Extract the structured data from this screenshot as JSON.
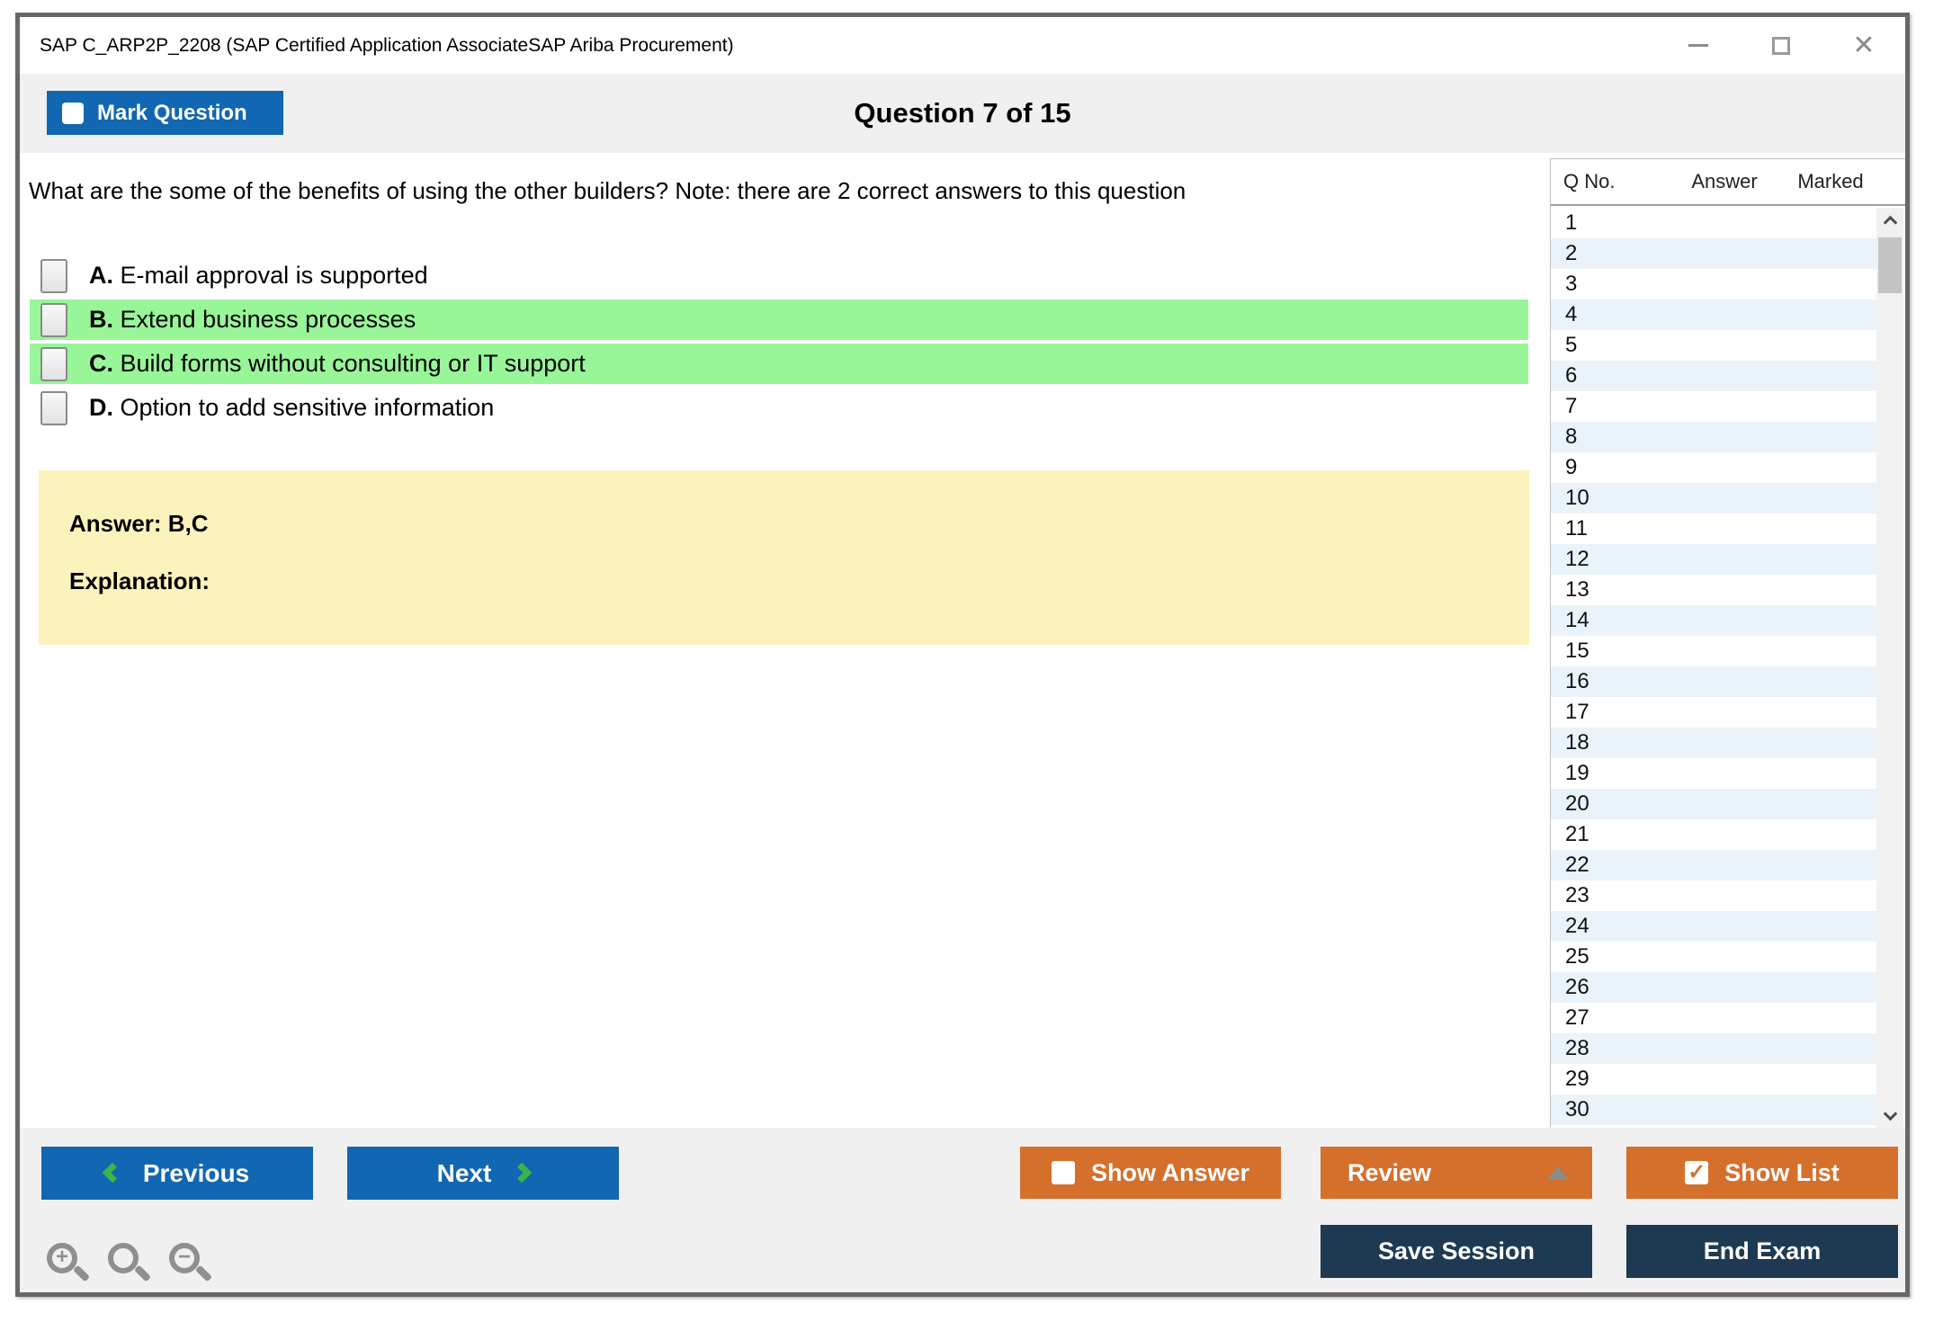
{
  "window": {
    "title": "SAP C_ARP2P_2208 (SAP Certified Application AssociateSAP Ariba Procurement)"
  },
  "header": {
    "mark_question_label": "Mark Question",
    "question_counter": "Question 7 of 15"
  },
  "question": {
    "text": "What are the some of the benefits of using the other builders? Note: there are 2 correct answers to this question",
    "options": [
      {
        "letter": "A.",
        "text": "E-mail approval is supported",
        "highlighted": false,
        "checked": false
      },
      {
        "letter": "B.",
        "text": "Extend business processes",
        "highlighted": true,
        "checked": false
      },
      {
        "letter": "C.",
        "text": "Build forms without consulting or IT support",
        "highlighted": true,
        "checked": false
      },
      {
        "letter": "D.",
        "text": "Option to add sensitive information",
        "highlighted": false,
        "checked": false
      }
    ]
  },
  "answer_panel": {
    "answer": "Answer: B,C",
    "explanation": "Explanation:"
  },
  "sidebar": {
    "columns": [
      "Q No.",
      "Answer",
      "Marked"
    ],
    "rows": [
      {
        "q": "1",
        "answer": "",
        "marked": ""
      },
      {
        "q": "2",
        "answer": "",
        "marked": ""
      },
      {
        "q": "3",
        "answer": "",
        "marked": ""
      },
      {
        "q": "4",
        "answer": "",
        "marked": ""
      },
      {
        "q": "5",
        "answer": "",
        "marked": ""
      },
      {
        "q": "6",
        "answer": "",
        "marked": ""
      },
      {
        "q": "7",
        "answer": "",
        "marked": ""
      },
      {
        "q": "8",
        "answer": "",
        "marked": ""
      },
      {
        "q": "9",
        "answer": "",
        "marked": ""
      },
      {
        "q": "10",
        "answer": "",
        "marked": ""
      },
      {
        "q": "11",
        "answer": "",
        "marked": ""
      },
      {
        "q": "12",
        "answer": "",
        "marked": ""
      },
      {
        "q": "13",
        "answer": "",
        "marked": ""
      },
      {
        "q": "14",
        "answer": "",
        "marked": ""
      },
      {
        "q": "15",
        "answer": "",
        "marked": ""
      },
      {
        "q": "16",
        "answer": "",
        "marked": ""
      },
      {
        "q": "17",
        "answer": "",
        "marked": ""
      },
      {
        "q": "18",
        "answer": "",
        "marked": ""
      },
      {
        "q": "19",
        "answer": "",
        "marked": ""
      },
      {
        "q": "20",
        "answer": "",
        "marked": ""
      },
      {
        "q": "21",
        "answer": "",
        "marked": ""
      },
      {
        "q": "22",
        "answer": "",
        "marked": ""
      },
      {
        "q": "23",
        "answer": "",
        "marked": ""
      },
      {
        "q": "24",
        "answer": "",
        "marked": ""
      },
      {
        "q": "25",
        "answer": "",
        "marked": ""
      },
      {
        "q": "26",
        "answer": "",
        "marked": ""
      },
      {
        "q": "27",
        "answer": "",
        "marked": ""
      },
      {
        "q": "28",
        "answer": "",
        "marked": ""
      },
      {
        "q": "29",
        "answer": "",
        "marked": ""
      },
      {
        "q": "30",
        "answer": "",
        "marked": ""
      }
    ]
  },
  "footer": {
    "previous_label": "Previous",
    "next_label": "Next",
    "show_answer_label": "Show Answer",
    "review_label": "Review",
    "show_list_label": "Show List",
    "save_session_label": "Save Session",
    "end_exam_label": "End Exam",
    "show_answer_checked": false,
    "show_list_checked": true,
    "show_list_check_glyph": "✓",
    "zoom_icons": [
      "zoom-in-icon",
      "zoom-reset-icon",
      "zoom-out-icon"
    ]
  },
  "colors": {
    "primary_blue": "#1167b1",
    "accent_orange": "#d5702c",
    "dark_navy": "#1e3a52",
    "highlight_green": "#98f698",
    "answer_yellow": "#fbf3bb",
    "row_stripe_blue": "#eaf3fa",
    "chevron_green": "#3ab54a"
  }
}
